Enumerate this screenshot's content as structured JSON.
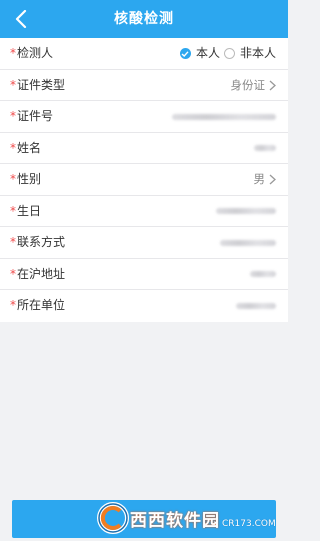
{
  "header": {
    "title": "核酸检测"
  },
  "form": {
    "required_mark": "*",
    "detect_person": {
      "label": "检测人",
      "option_self": "本人",
      "option_other": "非本人"
    },
    "id_type": {
      "label": "证件类型",
      "value": "身份证"
    },
    "id_number": {
      "label": "证件号"
    },
    "name": {
      "label": "姓名"
    },
    "gender": {
      "label": "性别",
      "value": "男"
    },
    "birthday": {
      "label": "生日"
    },
    "contact": {
      "label": "联系方式"
    },
    "address": {
      "label": "在沪地址"
    },
    "employer": {
      "label": "所在单位"
    }
  },
  "watermark": {
    "text_cn": "西西软件园",
    "text_en": "CR173.COM"
  },
  "colors": {
    "accent": "#2ca7ef",
    "required": "#f04b4b"
  }
}
